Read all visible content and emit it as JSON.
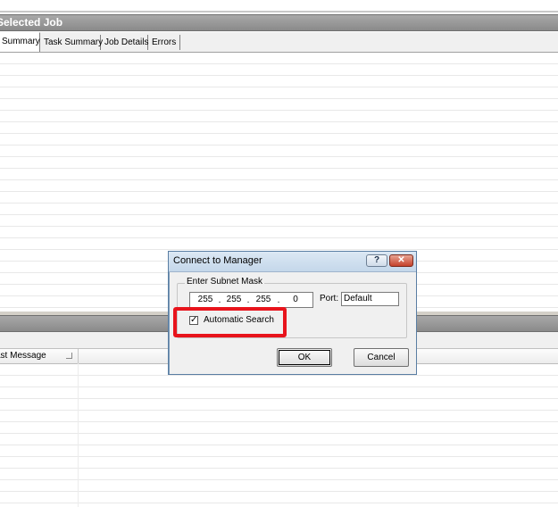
{
  "main_panel": {
    "header_title": "Selected Job",
    "tabs": [
      {
        "label": "Summary",
        "active": true
      },
      {
        "label": "Task Summary",
        "active": false
      },
      {
        "label": "Job Details",
        "active": false
      },
      {
        "label": "Errors",
        "active": false
      }
    ]
  },
  "lower_panel": {
    "column_header": "ast Message"
  },
  "dialog": {
    "title": "Connect to Manager",
    "help_label": "?",
    "close_label": "✕",
    "group_label": "Enter Subnet Mask",
    "subnet": [
      "255",
      "255",
      "255",
      "0"
    ],
    "subnet_separator": ".",
    "port_label": "Port:",
    "port_value": "Default",
    "auto_search_label": "Automatic Search",
    "auto_search_checked": true,
    "check_glyph": "✓",
    "ok_label": "OK",
    "cancel_label": "Cancel"
  },
  "colors": {
    "highlight": "#e8141c",
    "header_bg": "#8a8a8a"
  }
}
